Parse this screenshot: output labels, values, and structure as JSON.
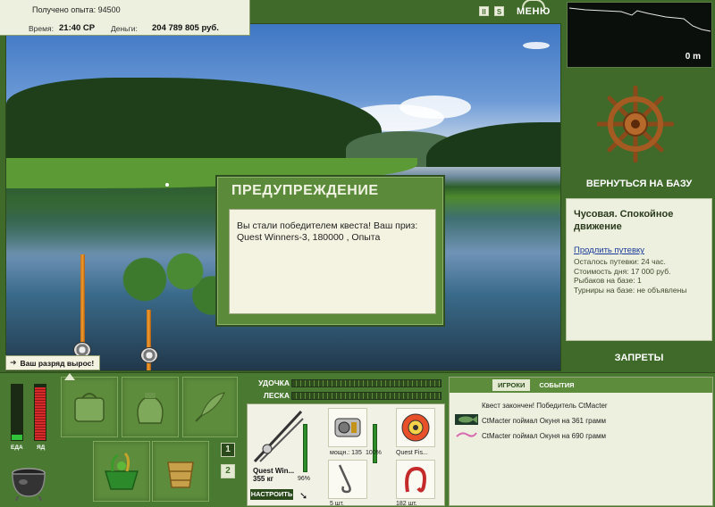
{
  "info": {
    "exp_gained": "Получено опыта: 94500",
    "time_label": "Время:",
    "time_value": "21:40 СР",
    "money_label": "Деньги:",
    "money_value": "204 789 805 руб."
  },
  "top_controls": {
    "pause": "II",
    "sound": "S",
    "menu": "МЕНЮ"
  },
  "depth": {
    "value": "0 m"
  },
  "right_panel": {
    "return_label": "ВЕРНУТЬСЯ НА БАЗУ",
    "location_title": "Чусовая. Спокойное движение",
    "extend_link": "Продлить путевку",
    "rows": [
      "Осталось путевки: 24 час.",
      "Стоимость дня: 17 000 руб.",
      "Рыбаков на базе: 1",
      "Турниры на базе: не объявлены"
    ],
    "bans_label": "ЗАПРЕТЫ"
  },
  "dialog": {
    "title": "ПРЕДУПРЕЖДЕНИЕ",
    "message": "Вы стали победителем квеста! Ваш приз: Quest Winners-3, 180000 , Опыта"
  },
  "toast": {
    "text": "Ваш разряд вырос!"
  },
  "meters": {
    "food_label": "ЕДА",
    "poison_label": "ЯД",
    "food_level": 0.1,
    "poison_level": 0.95,
    "food_color": "#31c23a",
    "poison_color": "#d62a2a"
  },
  "inventory": {
    "page1": "1",
    "page2": "2"
  },
  "tackle": {
    "rod_label": "УДОЧКА",
    "line_label": "ЛЕСКА",
    "rod_name": "Quest Win...",
    "rod_weight": "355 кг",
    "rod_percent": "96%",
    "reel_power": "мощн.: 135",
    "reel_percent": "100%",
    "line_name": "Quest Fis...",
    "hook_count": "5 шт.",
    "bait_count": "182 шт.",
    "setup_label": "НАСТРОИТЬ"
  },
  "chat": {
    "tab_players": "ИГРОКИ",
    "tab_events": "СОБЫТИЯ",
    "messages": [
      "Квест закончен! Победитель CtMacter",
      "CtMacter поймал Окуня на 361 грамм",
      "CtMacter поймал Окуня на 690 грамм"
    ]
  }
}
